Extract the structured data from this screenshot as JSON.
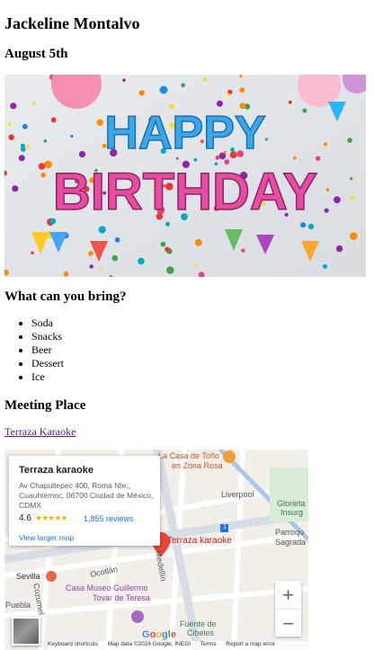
{
  "event": {
    "name": "Jackeline Montalvo",
    "date": "August 5th",
    "banner_letters_top": "HAPPY",
    "banner_letters_bottom": "BIRTHDAY"
  },
  "bring": {
    "heading": "What can you bring?",
    "items": [
      "Soda",
      "Snacks",
      "Beer",
      "Dessert",
      "Ice"
    ]
  },
  "meeting": {
    "heading": "Meeting Place",
    "link_text": "Terraza Karaoke"
  },
  "map": {
    "place_title": "Terraza karaoke",
    "address": "Av Chapultepec 400, Roma Nte., Cuauhtémoc, 06700 Ciudad de México, CDMX",
    "rating": "4.6",
    "stars": "★★★★★",
    "reviews": "1,855 reviews",
    "view_larger": "View larger map",
    "marker_label": "Terraza karaoke",
    "labels": {
      "casa_tono_1": "La Casa de Toño",
      "casa_tono_2": "en Zona Rosa",
      "liverpool": "Liverpool",
      "glorieta_1": "Glorieta",
      "glorieta_2": "Insurg",
      "parroquia_1": "Parroqu",
      "parroquia_2": "Sagrada",
      "medellin": "Medellín",
      "sevilla": "Sevilla",
      "ocotlan": "Ocotlán",
      "cozumel": "Cozumel",
      "museo_1": "Casa Museo Guillermo",
      "museo_2": "Tovar de Teresa",
      "puebla": "Puebla",
      "fuente_1": "Fuente de",
      "fuente_2": "Cibeles",
      "route": "1"
    },
    "zoom_in": "+",
    "zoom_out": "−",
    "google": "Google",
    "footer": {
      "shortcuts": "Keyboard shortcuts",
      "mapdata": "Map data ©2024 Google, INEGI",
      "terms": "Terms",
      "report": "Report a map error"
    }
  }
}
